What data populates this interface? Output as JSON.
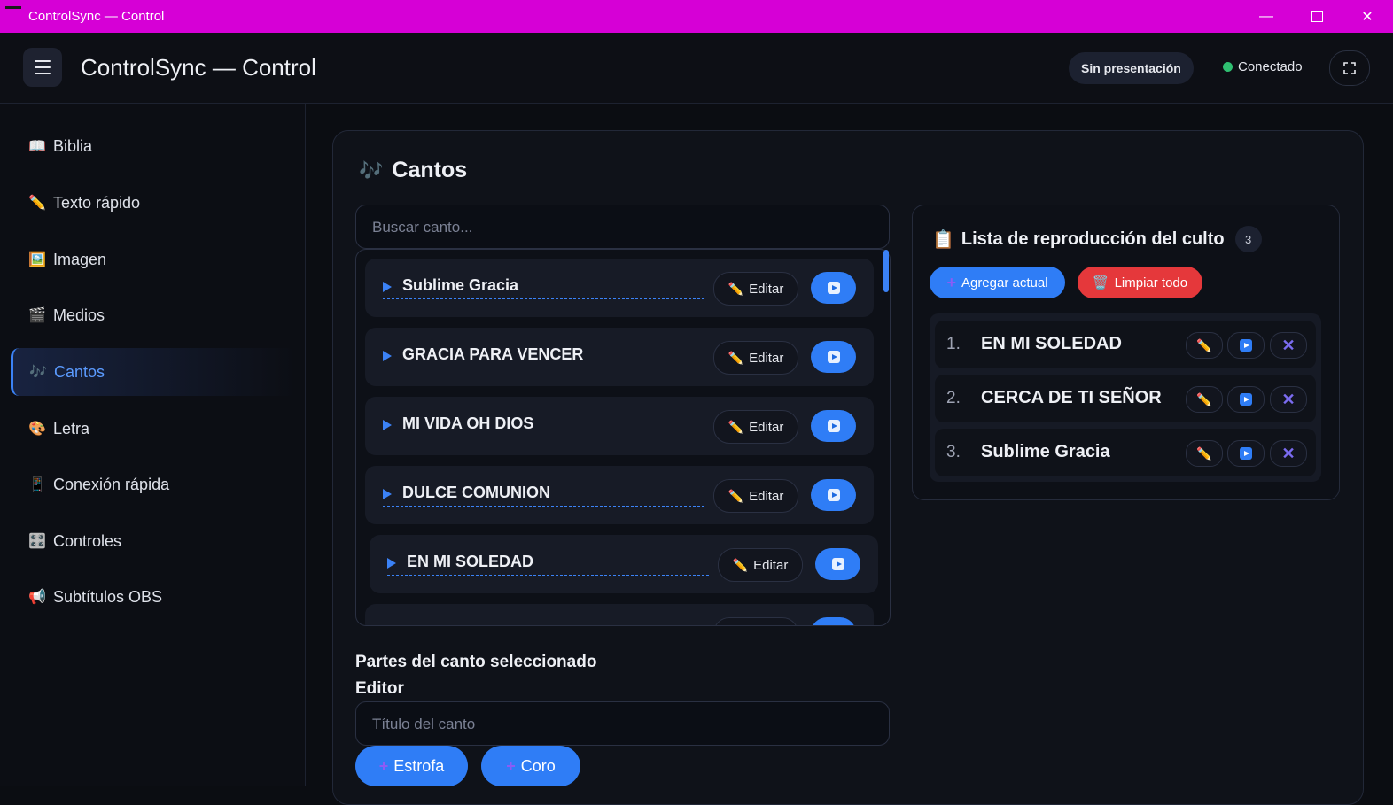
{
  "window": {
    "title": "ControlSync — Control"
  },
  "header": {
    "app_title": "ControlSync — Control",
    "presentation_status": "Sin presentación",
    "connection_status": "Conectado"
  },
  "sidebar": {
    "items": [
      {
        "icon": "📖",
        "label": "Biblia"
      },
      {
        "icon": "✏️",
        "label": "Texto rápido"
      },
      {
        "icon": "🖼️",
        "label": "Imagen"
      },
      {
        "icon": "🎬",
        "label": "Medios"
      },
      {
        "icon": "🎶",
        "label": "Cantos"
      },
      {
        "icon": "🎨",
        "label": "Letra"
      },
      {
        "icon": "📱",
        "label": "Conexión rápida"
      },
      {
        "icon": "🎛️",
        "label": "Controles"
      },
      {
        "icon": "📢",
        "label": "Subtítulos OBS"
      }
    ],
    "active": "Cantos"
  },
  "main": {
    "title_icon": "🎶",
    "title": "Cantos",
    "search_placeholder": "Buscar canto...",
    "edit_label": "Editar",
    "songs": [
      "Sublime Gracia",
      "GRACIA PARA VENCER",
      "MI VIDA OH DIOS",
      "DULCE COMUNION",
      "EN MI SOLEDAD"
    ]
  },
  "playlist": {
    "title_icon": "📋",
    "title": "Lista de reproducción del culto",
    "count": "3",
    "add_label": "Agregar actual",
    "clear_icon": "🗑️",
    "clear_label": "Limpiar todo",
    "items": [
      {
        "num": "1.",
        "name": "EN MI SOLEDAD"
      },
      {
        "num": "2.",
        "name": "CERCA DE TI SEÑOR"
      },
      {
        "num": "3.",
        "name": "Sublime Gracia"
      }
    ]
  },
  "editor": {
    "section_title": "Partes del canto seleccionado",
    "editor_title": "Editor",
    "title_placeholder": "Título del canto",
    "verse_label": "Estrofa",
    "chorus_label": "Coro"
  },
  "colors": {
    "accent": "#2f7df6",
    "titlebar": "#d600d6",
    "danger": "#e5383b",
    "connected": "#2fbf71"
  }
}
